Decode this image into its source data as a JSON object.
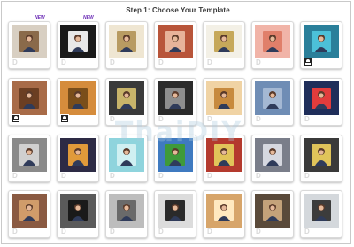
{
  "page": {
    "title": "Step 1: Choose Your Template"
  },
  "badges": {
    "new": "NEW"
  },
  "watermark": "ThaiDIY",
  "templates": [
    {
      "icon": "frame-gallery-icon",
      "bg": "#d8cfc2",
      "accent": "#8a6a4a",
      "new": true
    },
    {
      "icon": "sports-car-icon",
      "bg": "#1a1a1a",
      "accent": "#e8e8e8",
      "new": true
    },
    {
      "icon": "photo-frame-icon",
      "bg": "#efe6d2",
      "accent": "#b89b62"
    },
    {
      "icon": "brick-wall-icon",
      "bg": "#b8553a",
      "accent": "#e7b39a"
    },
    {
      "icon": "round-frame-icon",
      "bg": "#f3f0e6",
      "accent": "#c6a85a"
    },
    {
      "icon": "burst-frame-icon",
      "bg": "#f1b4a8",
      "accent": "#e07f6a"
    },
    {
      "icon": "camera-screen-icon",
      "bg": "#2a7f9a",
      "accent": "#4cc0d8",
      "user": true
    },
    {
      "icon": "building-billboard-icon",
      "bg": "#a86b48",
      "accent": "#6b3e22",
      "user": true
    },
    {
      "icon": "wooden-ring-icon",
      "bg": "#d58c3c",
      "accent": "#7a4e1a",
      "user": true
    },
    {
      "icon": "ornate-circle-icon",
      "bg": "#3a3a3a",
      "accent": "#c8b46a"
    },
    {
      "icon": "camera-hand-icon",
      "bg": "#2b2b2b",
      "accent": "#8e8e8e"
    },
    {
      "icon": "teddy-bear-icon",
      "bg": "#f0d3a4",
      "accent": "#c78a3e"
    },
    {
      "icon": "city-street-icon",
      "bg": "#6f8db5",
      "accent": "#a4b8d3"
    },
    {
      "icon": "times-square-icon",
      "bg": "#1f2e5a",
      "accent": "#e23c3c"
    },
    {
      "icon": "bw-street-icon",
      "bg": "#8a8a8a",
      "accent": "#d0d0d0"
    },
    {
      "icon": "night-city-icon",
      "bg": "#2d2b45",
      "accent": "#e09a3a"
    },
    {
      "icon": "bubble-frame-icon",
      "bg": "#8fd4dd",
      "accent": "#d0f0f2"
    },
    {
      "icon": "stadium-screen-icon",
      "bg": "#3f7ac0",
      "accent": "#3f9a3a"
    },
    {
      "icon": "red-billboard-icon",
      "bg": "#b43a2e",
      "accent": "#e1c45a"
    },
    {
      "icon": "tower-screen-icon",
      "bg": "#7a7e8a",
      "accent": "#d6d8e0"
    },
    {
      "icon": "phones-icon",
      "bg": "#3a3a3a",
      "accent": "#e0c45a"
    },
    {
      "icon": "brick-street-icon",
      "bg": "#8a5a42",
      "accent": "#d09c6a"
    },
    {
      "icon": "crystal-ball-icon",
      "bg": "#5a5a5a",
      "accent": "#1a1a1a"
    },
    {
      "icon": "bw-frame-icon",
      "bg": "#bdbdbd",
      "accent": "#6a6a6a"
    },
    {
      "icon": "dark-phone-icon",
      "bg": "#dcdcdc",
      "accent": "#2a2a2a"
    },
    {
      "icon": "gold-grid-icon",
      "bg": "#d7a56a",
      "accent": "#ffe9c0"
    },
    {
      "icon": "tv-screen-icon",
      "bg": "#5a4a3a",
      "accent": "#c4a27a"
    },
    {
      "icon": "mobile-phone-icon",
      "bg": "#d4d8dc",
      "accent": "#3c3c3c"
    }
  ]
}
